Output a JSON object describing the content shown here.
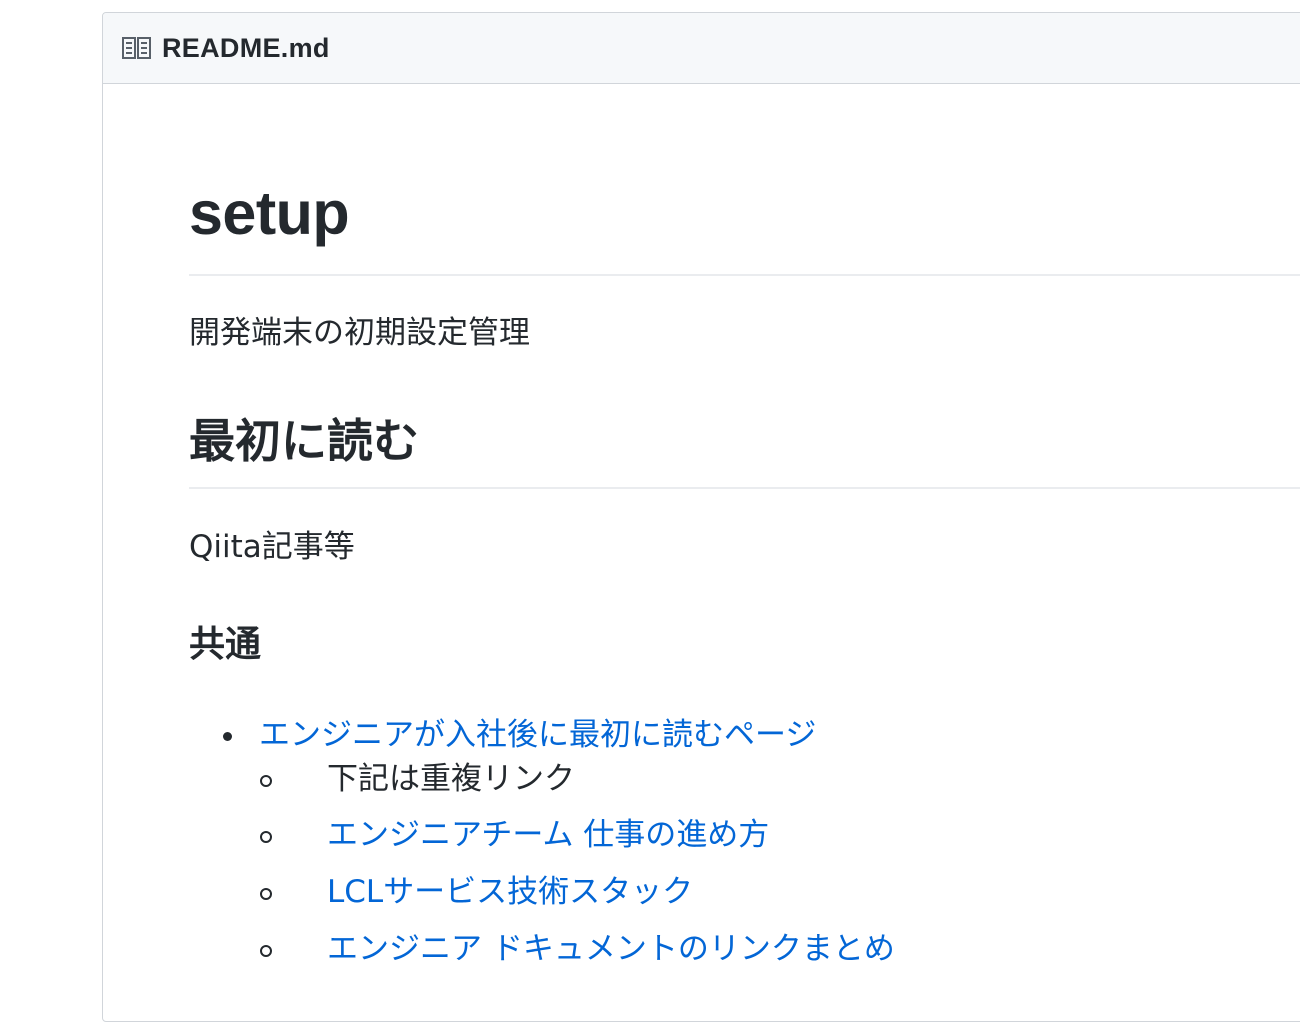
{
  "readme": {
    "filename": "README.md",
    "icon": "book-icon"
  },
  "content": {
    "title": "setup",
    "description": "開発端末の初期設定管理",
    "section_heading": "最初に読む",
    "section_text": "Qiita記事等",
    "subsection_heading": "共通",
    "list": [
      {
        "label": "エンジニアが入社後に最初に読むページ",
        "is_link": true,
        "children": [
          {
            "label": "下記は重複リンク",
            "is_link": false
          },
          {
            "label": "エンジニアチーム 仕事の進め方",
            "is_link": true
          },
          {
            "label": "LCLサービス技術スタック",
            "is_link": true
          },
          {
            "label": "エンジニア ドキュメントのリンクまとめ",
            "is_link": true
          }
        ]
      }
    ]
  },
  "colors": {
    "link": "#0366d6",
    "text": "#24292e",
    "header_bg": "#f6f8fa",
    "border": "#d1d5da"
  }
}
